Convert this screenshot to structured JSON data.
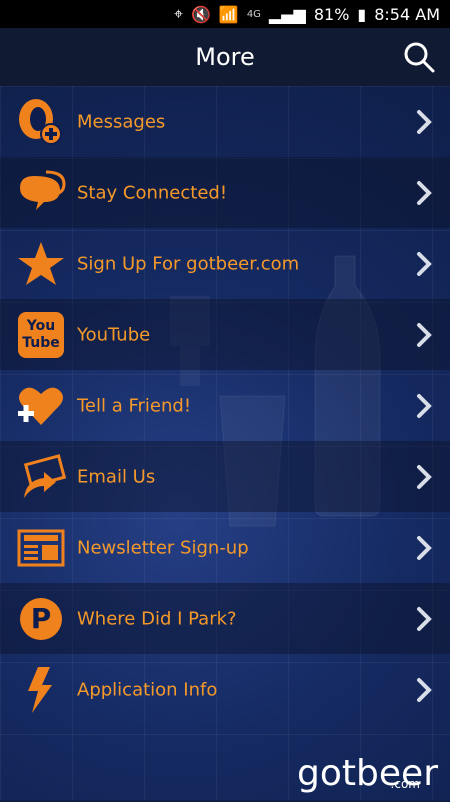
{
  "status_bar": {
    "network": "4G",
    "battery": "81%",
    "time": "8:54 AM"
  },
  "header": {
    "title": "More",
    "search_icon": "search-icon"
  },
  "menu": {
    "items": [
      {
        "label": "Messages",
        "icon": "megaphone-add-icon"
      },
      {
        "label": "Stay Connected!",
        "icon": "chat-bubbles-icon"
      },
      {
        "label": "Sign Up For gotbeer.com",
        "icon": "star-icon"
      },
      {
        "label": "YouTube",
        "icon": "youtube-icon",
        "icon_text": "You\nTube"
      },
      {
        "label": "Tell a Friend!",
        "icon": "heart-add-icon"
      },
      {
        "label": "Email Us",
        "icon": "email-share-icon"
      },
      {
        "label": "Newsletter Sign-up",
        "icon": "newspaper-icon"
      },
      {
        "label": "Where Did I Park?",
        "icon": "parking-icon",
        "icon_text": "P"
      },
      {
        "label": "Application Info",
        "icon": "lightning-icon"
      }
    ]
  },
  "brand": {
    "logo_text": "gotbeer",
    "logo_suffix": ".com"
  },
  "colors": {
    "accent": "#f59a2a",
    "header_bg": "#101a33",
    "page_bg": "#0f1f4a"
  }
}
